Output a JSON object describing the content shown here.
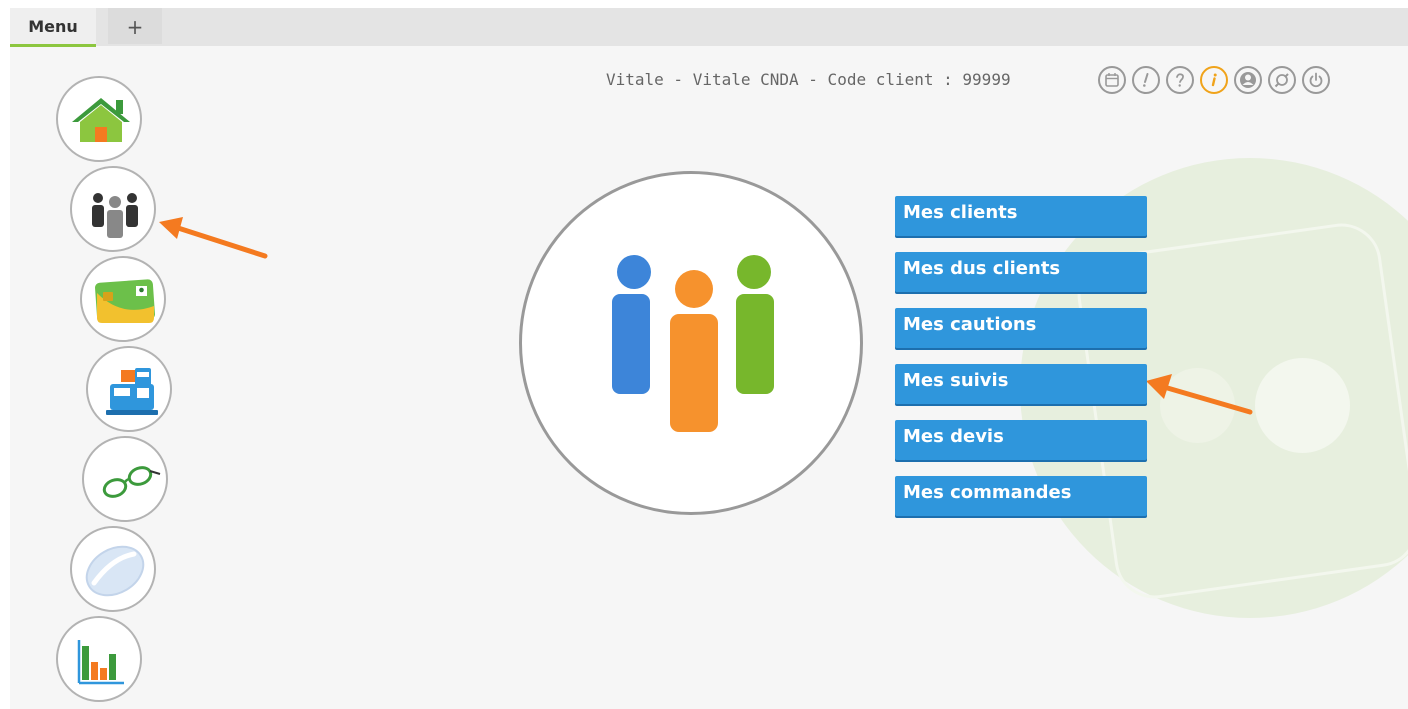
{
  "tabs": [
    {
      "label": "Menu"
    },
    {
      "label": "+"
    }
  ],
  "header": {
    "info": "Vitale - Vitale CNDA - Code client : 99999"
  },
  "toolbar_icons": [
    "calendar-icon",
    "alert-icon",
    "help-icon",
    "info-icon",
    "user-icon",
    "settings-icon",
    "power-icon"
  ],
  "sidebar": {
    "items": [
      {
        "name": "home-icon"
      },
      {
        "name": "clients-icon"
      },
      {
        "name": "vitale-card-icon"
      },
      {
        "name": "cash-register-icon"
      },
      {
        "name": "glasses-icon"
      },
      {
        "name": "lens-icon"
      },
      {
        "name": "statistics-icon"
      }
    ]
  },
  "main": {
    "icon": "clients-icon",
    "menu": [
      {
        "label": "Mes clients"
      },
      {
        "label": "Mes dus clients"
      },
      {
        "label": "Mes cautions"
      },
      {
        "label": "Mes suivis"
      },
      {
        "label": "Mes devis"
      },
      {
        "label": "Mes commandes"
      }
    ]
  },
  "colors": {
    "accent": "#2f96dc",
    "tab_underline": "#8cc63f",
    "arrow": "#f47a20"
  }
}
